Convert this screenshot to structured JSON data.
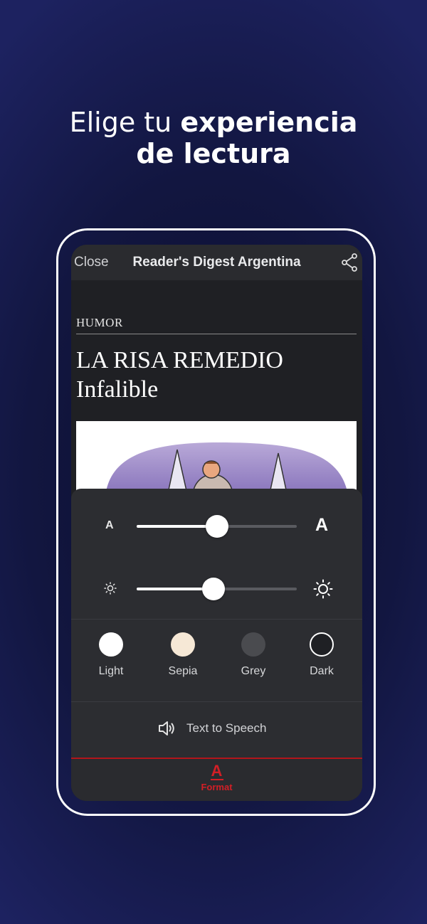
{
  "headline": {
    "line1_normal": "Elige tu ",
    "line1_bold": "experiencia",
    "line2_bold": "de lectura"
  },
  "navbar": {
    "close_label": "Close",
    "title": "Reader's Digest Argentina",
    "share_icon": "share-icon"
  },
  "article": {
    "section": "HUMOR",
    "title_line1": "LA RISA REMEDIO",
    "title_line2": "Infalible"
  },
  "format_panel": {
    "font_size": {
      "min_icon": "A",
      "max_icon": "A",
      "value": 0.5
    },
    "brightness": {
      "min_icon": "brightness-low-icon",
      "max_icon": "brightness-high-icon",
      "value": 0.48
    },
    "themes": [
      {
        "label": "Light",
        "color": "#ffffff"
      },
      {
        "label": "Sepia",
        "color": "#f6e8d6"
      },
      {
        "label": "Grey",
        "color": "#4a4b4f"
      },
      {
        "label": "Dark",
        "color": "#1f2024"
      }
    ],
    "tts_label": "Text to Speech"
  },
  "tabbar": {
    "format_icon": "A",
    "format_label": "Format",
    "accent": "#d21f26"
  }
}
